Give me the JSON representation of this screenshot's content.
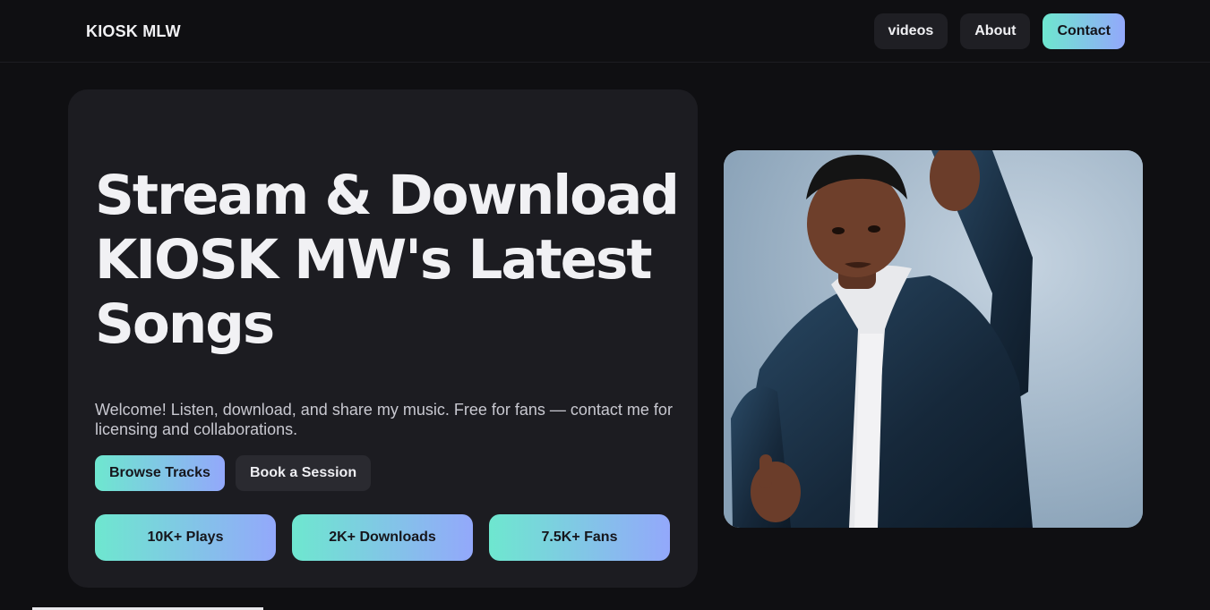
{
  "header": {
    "brand": "KIOSK MLW",
    "nav": [
      {
        "label": "videos"
      },
      {
        "label": "About"
      },
      {
        "label": "Contact"
      }
    ]
  },
  "hero": {
    "headline_lines": [
      "Stream & Download",
      "KIOSK MW's Latest",
      "Songs"
    ],
    "subtitle": "Welcome! Listen, download, and share my music. Free for fans — contact me for licensing and collaborations.",
    "buttons": {
      "primary": "Browse Tracks",
      "secondary": "Book a Session"
    },
    "stats": [
      {
        "label": "10K+ Plays"
      },
      {
        "label": "2K+ Downloads"
      },
      {
        "label": "7.5K+ Fans"
      }
    ]
  },
  "colors": {
    "background": "#0f0f12",
    "card": "#1c1c21",
    "accent_start": "#6ee7cf",
    "accent_end": "#93a8fb"
  }
}
